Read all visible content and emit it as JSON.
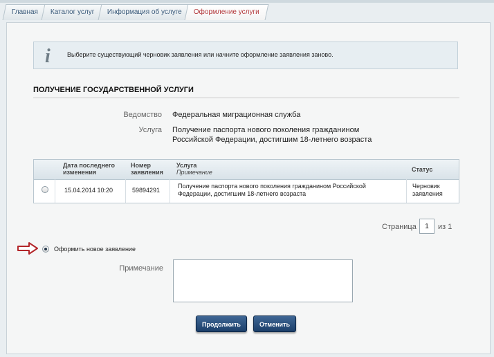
{
  "breadcrumbs": [
    {
      "label": "Главная"
    },
    {
      "label": "Каталог услуг"
    },
    {
      "label": "Информация об услуге"
    },
    {
      "label": "Оформление услуги"
    }
  ],
  "info": {
    "message": "Выберите существующий черновик заявления или начните оформление заявления заново."
  },
  "section": {
    "title": "ПОЛУЧЕНИЕ ГОСУДАРСТВЕННОЙ УСЛУГИ"
  },
  "details": {
    "agency_label": "Ведомство",
    "agency_value": "Федеральная миграционная служба",
    "service_label": "Услуга",
    "service_value_line1": "Получение паспорта нового поколения гражданином",
    "service_value_line2": "Российской Федерации, достигшим 18-летнего возраста"
  },
  "table": {
    "headers": {
      "date_line1": "Дата последнего",
      "date_line2": "изменения",
      "number_line1": "Номер",
      "number_line2": "заявления",
      "service": "Услуга",
      "note": "Примечание",
      "status": "Статус"
    },
    "rows": [
      {
        "date": "15.04.2014 10:20",
        "number": "59894291",
        "service_line1": "Получение паспорта нового поколения гражданином Российской",
        "service_line2": "Федерации, достигшим 18-летнего возраста",
        "status_line1": "Черновик",
        "status_line2": "заявления"
      }
    ]
  },
  "pager": {
    "label": "Страница",
    "current": "1",
    "of": "из 1"
  },
  "new_application": {
    "label": "Оформить новое заявление"
  },
  "note": {
    "label": "Примечание",
    "value": ""
  },
  "buttons": {
    "continue": "Продолжить",
    "cancel": "Отменить"
  },
  "colors": {
    "active_tab": "#b3373a",
    "button": "#1c3f6a",
    "arrow": "#b3262a"
  }
}
